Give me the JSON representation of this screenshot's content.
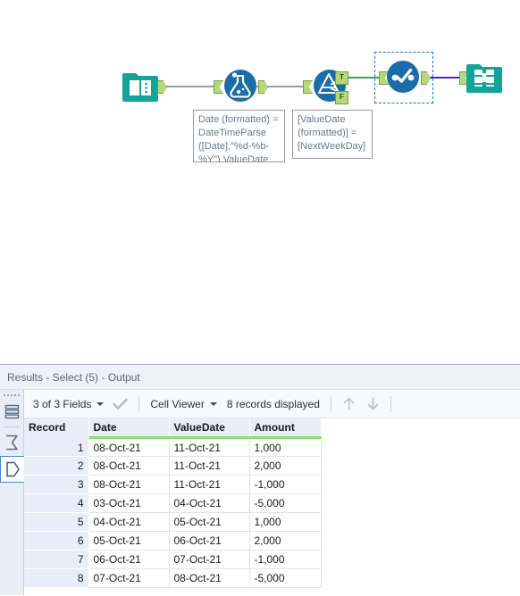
{
  "canvas": {
    "tools": [
      {
        "id": "input-data",
        "name": "Input Data",
        "icon": "book-folder-icon",
        "selected": false
      },
      {
        "id": "formula",
        "name": "Formula",
        "icon": "flask-icon",
        "selected": false
      },
      {
        "id": "filter",
        "name": "Filter",
        "icon": "funnel-icon",
        "selected": false
      },
      {
        "id": "select",
        "name": "Select",
        "icon": "checkmark-circle-icon",
        "selected": true
      },
      {
        "id": "browse",
        "name": "Browse",
        "icon": "binoculars-icon",
        "selected": false
      }
    ],
    "filter_outputs": {
      "true_label": "T",
      "false_label": "F"
    },
    "annotations": [
      {
        "id": "formula-annotation",
        "text": "Date (formatted) = DateTimeParse ([Date],\"%d-%b-%Y\") ValueDate (formatted) = Date..."
      },
      {
        "id": "filter-annotation",
        "text": "[ValueDate (formatted)] = [NextWeekDay]"
      }
    ],
    "colors": {
      "wire_default": "#9a9a9a",
      "wire_true": "#2eaa4e",
      "wire_selected": "#4b1fd0",
      "tool_blue": "#1b6ca8",
      "tool_teal": "#12a39a",
      "anchor_green": "#b5d97a",
      "selection_blue": "#1f6fd0"
    }
  },
  "results": {
    "title": "Results - Select (5) - Output",
    "rail": [
      {
        "id": "rail-messages",
        "name": "messages-icon",
        "active": false
      },
      {
        "id": "rail-input",
        "name": "input-anchor-icon",
        "active": false
      },
      {
        "id": "rail-output",
        "name": "output-anchor-icon",
        "active": true
      }
    ],
    "toolbar": {
      "fields_label": "3 of 3 Fields",
      "check_icon": "checkmark-icon",
      "viewer_label": "Cell Viewer",
      "records_label": "8 records displayed",
      "nav_up_icon": "arrow-up-icon",
      "nav_down_icon": "arrow-down-icon"
    },
    "grid": {
      "columns": [
        {
          "key": "record",
          "label": "Record",
          "typed": false
        },
        {
          "key": "date",
          "label": "Date",
          "typed": true
        },
        {
          "key": "valuedate",
          "label": "ValueDate",
          "typed": true
        },
        {
          "key": "amount",
          "label": "Amount",
          "typed": true
        }
      ],
      "rows": [
        {
          "record": "1",
          "date": "08-Oct-21",
          "valuedate": "11-Oct-21",
          "amount": "1,000"
        },
        {
          "record": "2",
          "date": "08-Oct-21",
          "valuedate": "11-Oct-21",
          "amount": "2,000"
        },
        {
          "record": "3",
          "date": "08-Oct-21",
          "valuedate": "11-Oct-21",
          "amount": "-1,000"
        },
        {
          "record": "4",
          "date": "03-Oct-21",
          "valuedate": "04-Oct-21",
          "amount": "-5,000"
        },
        {
          "record": "5",
          "date": "04-Oct-21",
          "valuedate": "05-Oct-21",
          "amount": "1,000"
        },
        {
          "record": "6",
          "date": "05-Oct-21",
          "valuedate": "06-Oct-21",
          "amount": "2,000"
        },
        {
          "record": "7",
          "date": "06-Oct-21",
          "valuedate": "07-Oct-21",
          "amount": "-1,000"
        },
        {
          "record": "8",
          "date": "07-Oct-21",
          "valuedate": "08-Oct-21",
          "amount": "-5,000"
        }
      ]
    }
  }
}
